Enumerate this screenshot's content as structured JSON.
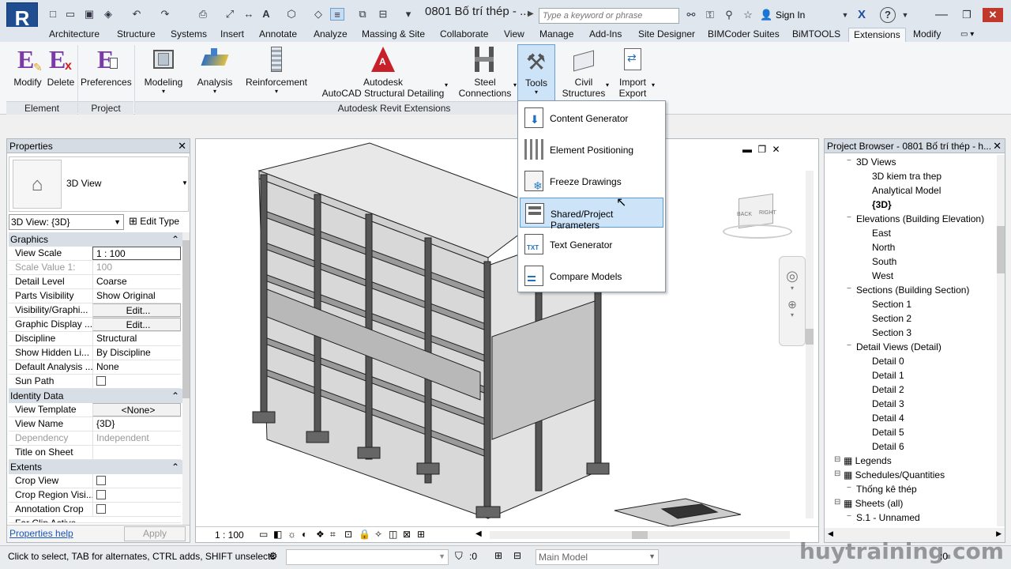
{
  "app": {
    "logo": "R",
    "document_title": "0801 Bố trí thép - ..."
  },
  "search": {
    "placeholder": "Type a keyword or phrase"
  },
  "account": {
    "sign_in": "Sign In"
  },
  "tabs": [
    "Architecture",
    "Structure",
    "Systems",
    "Insert",
    "Annotate",
    "Analyze",
    "Massing & Site",
    "Collaborate",
    "View",
    "Manage",
    "Add-Ins",
    "Site Designer",
    "BIMCoder Suites",
    "BiMTOOLS",
    "Extensions",
    "Modify"
  ],
  "active_tab": "Extensions",
  "ribbon": {
    "buttons": {
      "modify": "Modify",
      "delete": "Delete",
      "preferences": "Preferences",
      "modeling": "Modeling",
      "analysis": "Analysis",
      "reinforcement": "Reinforcement",
      "autodesk_1": "Autodesk",
      "autodesk_2": "AutoCAD Structural Detailing",
      "steel_1": "Steel",
      "steel_2": "Connections",
      "tools": "Tools",
      "civil_1": "Civil",
      "civil_2": "Structures",
      "import_1": "Import",
      "import_2": "Export"
    },
    "groups": {
      "element": "Element",
      "project": "Project",
      "extensions": "Autodesk Revit Extensions"
    }
  },
  "tools_menu": [
    {
      "label": "Content Generator",
      "icon": "content-generator-icon"
    },
    {
      "label": "Element Positioning",
      "icon": "element-positioning-icon"
    },
    {
      "label": "Freeze Drawings",
      "icon": "freeze-drawings-icon"
    },
    {
      "label": "Shared/Project Parameters",
      "icon": "shared-parameters-icon",
      "highlighted": true
    },
    {
      "label": "Text Generator",
      "icon": "text-generator-icon",
      "icon_text": "TXT"
    },
    {
      "label": "Compare Models",
      "icon": "compare-models-icon"
    }
  ],
  "properties": {
    "title": "Properties",
    "type_name": "3D View",
    "selector": "3D View: {3D}",
    "edit_type": "Edit Type",
    "sections": {
      "graphics": "Graphics",
      "identity": "Identity Data",
      "extents": "Extents"
    },
    "graphics": [
      {
        "k": "View Scale",
        "v": "1 : 100"
      },
      {
        "k": "Scale Value    1:",
        "v": "100"
      },
      {
        "k": "Detail Level",
        "v": "Coarse"
      },
      {
        "k": "Parts Visibility",
        "v": "Show Original"
      },
      {
        "k": "Visibility/Graphi...",
        "v": "Edit..."
      },
      {
        "k": "Graphic Display ...",
        "v": "Edit..."
      },
      {
        "k": "Discipline",
        "v": "Structural"
      },
      {
        "k": "Show Hidden Li...",
        "v": "By Discipline"
      },
      {
        "k": "Default Analysis ...",
        "v": "None"
      },
      {
        "k": "Sun Path",
        "v": ""
      }
    ],
    "identity": [
      {
        "k": "View Template",
        "v": "<None>"
      },
      {
        "k": "View Name",
        "v": "{3D}"
      },
      {
        "k": "Dependency",
        "v": "Independent"
      },
      {
        "k": "Title on Sheet",
        "v": ""
      }
    ],
    "extents": [
      {
        "k": "Crop View",
        "v": ""
      },
      {
        "k": "Crop Region Visi...",
        "v": ""
      },
      {
        "k": "Annotation Crop",
        "v": ""
      },
      {
        "k": "Far Clip Active",
        "v": ""
      }
    ],
    "help": "Properties help",
    "apply": "Apply"
  },
  "viewport": {
    "scale": "1 : 100",
    "viewcube_left": "BACK",
    "viewcube_right": "RIGHT"
  },
  "browser": {
    "title": "Project Browser - 0801 Bố trí thép - h...",
    "items": [
      {
        "t": "3D Views",
        "lvl": 1
      },
      {
        "t": "3D kiem tra thep",
        "lvl": 2
      },
      {
        "t": "Analytical Model",
        "lvl": 2
      },
      {
        "t": "{3D}",
        "lvl": 2,
        "bold": true
      },
      {
        "t": "Elevations (Building Elevation)",
        "lvl": 1
      },
      {
        "t": "East",
        "lvl": 2
      },
      {
        "t": "North",
        "lvl": 2
      },
      {
        "t": "South",
        "lvl": 2
      },
      {
        "t": "West",
        "lvl": 2
      },
      {
        "t": "Sections (Building Section)",
        "lvl": 1
      },
      {
        "t": "Section 1",
        "lvl": 2
      },
      {
        "t": "Section 2",
        "lvl": 2
      },
      {
        "t": "Section 3",
        "lvl": 2
      },
      {
        "t": "Detail Views (Detail)",
        "lvl": 1
      },
      {
        "t": "Detail 0",
        "lvl": 2
      },
      {
        "t": "Detail 1",
        "lvl": 2
      },
      {
        "t": "Detail 2",
        "lvl": 2
      },
      {
        "t": "Detail 3",
        "lvl": 2
      },
      {
        "t": "Detail 4",
        "lvl": 2
      },
      {
        "t": "Detail 5",
        "lvl": 2
      },
      {
        "t": "Detail 6",
        "lvl": 2
      },
      {
        "t": "Legends",
        "lvl": 0
      },
      {
        "t": "Schedules/Quantities",
        "lvl": 0
      },
      {
        "t": "Thống kê thép",
        "lvl": 1
      },
      {
        "t": "Sheets (all)",
        "lvl": 0
      },
      {
        "t": "S.1 - Unnamed",
        "lvl": 1
      }
    ]
  },
  "status": {
    "message": "Click to select, TAB for alternates, CTRL adds, SHIFT unselects",
    "count_1": ":0",
    "model": "Main Model",
    "count_2": ":0",
    "watermark": "huytraining.com"
  },
  "colors": {
    "accent": "#1f4d8f",
    "highlight": "#cde3f7",
    "panel_header": "#d6dce4"
  }
}
